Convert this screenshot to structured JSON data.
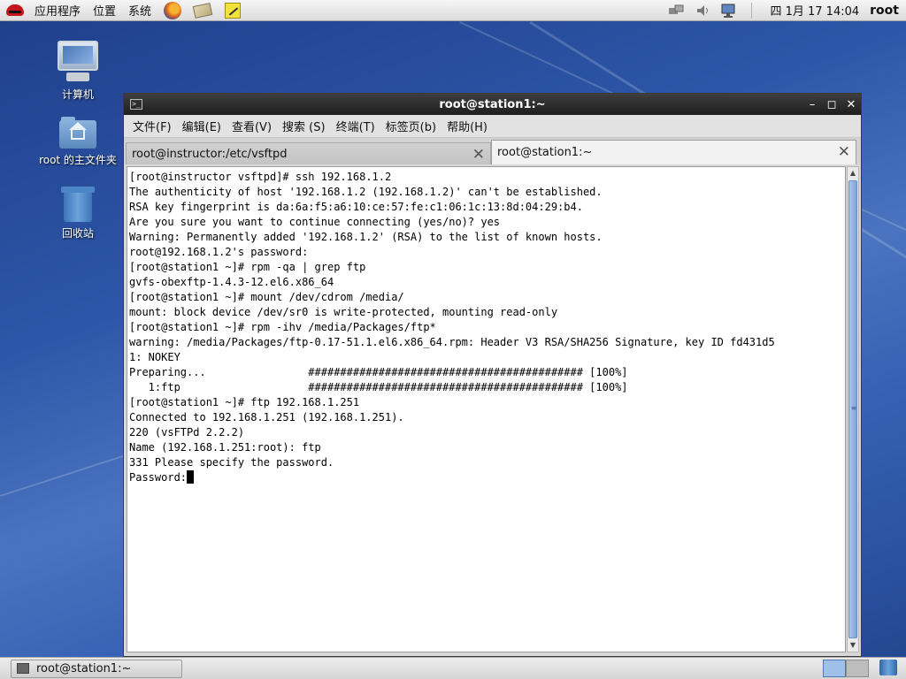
{
  "top_panel": {
    "menus": [
      "应用程序",
      "位置",
      "系统"
    ],
    "clock": "四 1月 17 14:04",
    "user": "root"
  },
  "desktop": {
    "icons": [
      {
        "label": "计算机",
        "icon": "computer-icon"
      },
      {
        "label": "root 的主文件夹",
        "icon": "home-folder-icon"
      },
      {
        "label": "回收站",
        "icon": "trash-icon"
      }
    ]
  },
  "window": {
    "title": "root@station1:~",
    "menu": [
      "文件(F)",
      "编辑(E)",
      "查看(V)",
      "搜索 (S)",
      "终端(T)",
      "标签页(b)",
      "帮助(H)"
    ],
    "tabs": [
      {
        "label": "root@instructor:/etc/vsftpd",
        "active": false
      },
      {
        "label": "root@station1:~",
        "active": true
      }
    ],
    "terminal_lines": [
      "[root@instructor vsftpd]# ssh 192.168.1.2",
      "The authenticity of host '192.168.1.2 (192.168.1.2)' can't be established.",
      "RSA key fingerprint is da:6a:f5:a6:10:ce:57:fe:c1:06:1c:13:8d:04:29:b4.",
      "Are you sure you want to continue connecting (yes/no)? yes",
      "Warning: Permanently added '192.168.1.2' (RSA) to the list of known hosts.",
      "root@192.168.1.2's password:",
      "[root@station1 ~]# rpm -qa | grep ftp",
      "gvfs-obexftp-1.4.3-12.el6.x86_64",
      "[root@station1 ~]# mount /dev/cdrom /media/",
      "mount: block device /dev/sr0 is write-protected, mounting read-only",
      "[root@station1 ~]# rpm -ihv /media/Packages/ftp*",
      "warning: /media/Packages/ftp-0.17-51.1.el6.x86_64.rpm: Header V3 RSA/SHA256 Signature, key ID fd431d5",
      "1: NOKEY",
      "Preparing...                ########################################### [100%]",
      "   1:ftp                    ########################################### [100%]",
      "[root@station1 ~]# ftp 192.168.1.251",
      "Connected to 192.168.1.251 (192.168.1.251).",
      "220 (vsFTPd 2.2.2)",
      "Name (192.168.1.251:root): ftp",
      "331 Please specify the password.",
      "Password:"
    ]
  },
  "bottom_panel": {
    "task_label": "root@station1:~"
  },
  "colors": {
    "titlebar": "#2a2a2a",
    "desktop": "#2d56a8",
    "scroll_thumb": "#7ea4d6"
  }
}
